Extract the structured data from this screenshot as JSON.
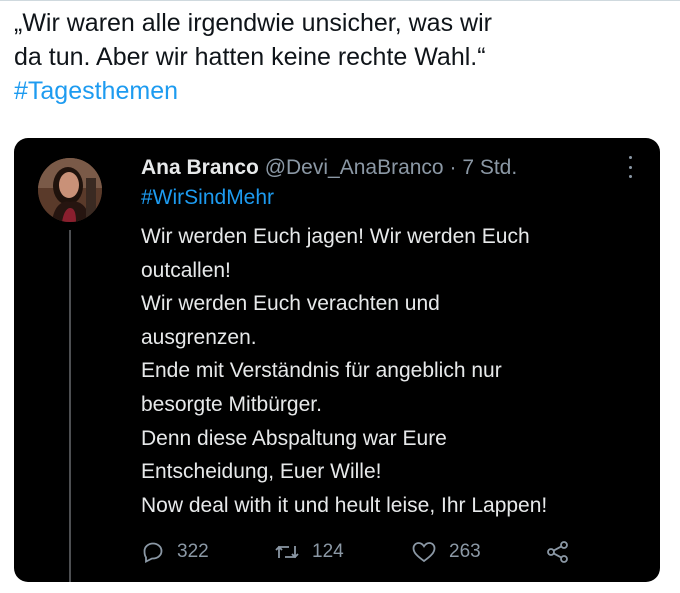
{
  "caption": {
    "lines": [
      "„Wir waren alle irgendwie unsicher, was wir",
      "da tun. Aber wir hatten keine rechte Wahl.“"
    ],
    "hashtag": "#Tagesthemen"
  },
  "tweet": {
    "author_name": "Ana Branco",
    "handle": "@Devi_AnaBranco",
    "separator": "·",
    "time": "7 Std.",
    "hashtag": "#WirSindMehr",
    "body_lines": [
      "Wir werden Euch jagen! Wir werden Euch",
      "outcallen!",
      "Wir werden Euch verachten und",
      "ausgrenzen.",
      "Ende mit Verständnis für angeblich nur",
      "besorgte Mitbürger.",
      "Denn diese Abspaltung war Eure",
      "Entscheidung, Euer Wille!",
      "Now deal with it und heult leise, Ihr Lappen!"
    ],
    "replies": "322",
    "retweets": "124",
    "likes": "263",
    "icons": {
      "reply": "reply-icon",
      "retweet": "retweet-icon",
      "like": "heart-icon",
      "share": "share-icon",
      "more": "more-icon"
    }
  },
  "colors": {
    "link": "#1d9bf0",
    "card_background": "#000000",
    "muted_text": "#8b98a5"
  }
}
